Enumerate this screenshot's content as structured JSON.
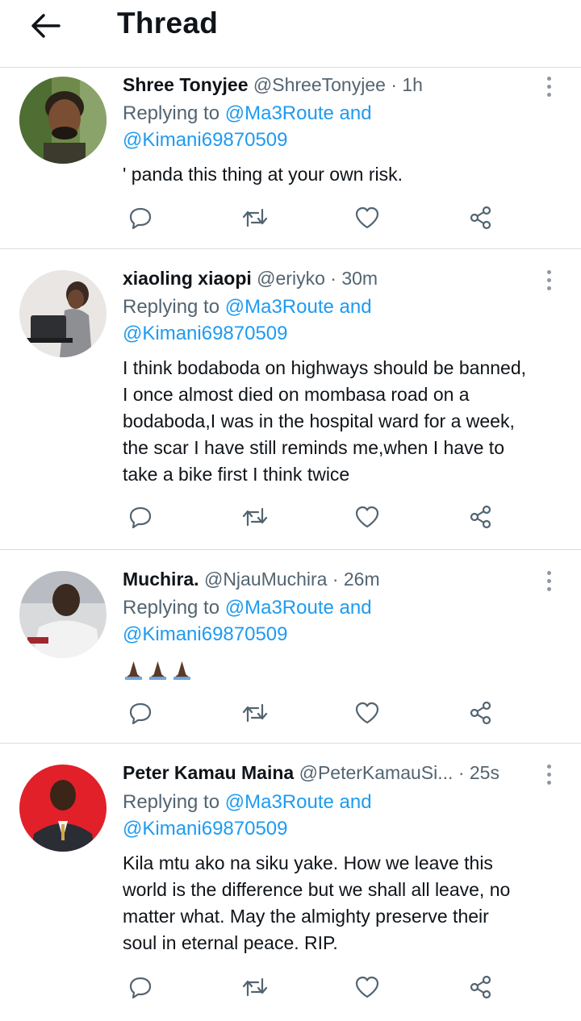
{
  "header": {
    "title": "Thread",
    "back_icon": "arrow-left-icon"
  },
  "tweets": [
    {
      "name": "Shree Tonyjee",
      "handle": "@ShreeTonyjee",
      "dot": "·",
      "time": "1h",
      "replying_prefix": "Replying to",
      "reply_user_1": "@Ma3Route",
      "reply_and": "and",
      "reply_user_2": "@Kimani69870509",
      "text": "' panda this thing at your own risk."
    },
    {
      "name": "xiaoling xiaopi",
      "handle": "@eriyko",
      "dot": "·",
      "time": "30m",
      "replying_prefix": "Replying to",
      "reply_user_1": "@Ma3Route",
      "reply_and": "and",
      "reply_user_2": "@Kimani69870509",
      "text_lines": [
        "I think bodaboda on highways should be banned,",
        "I once almost died on mombasa road on a",
        "bodaboda,I was in the hospital ward for a week,",
        "the scar I have still reminds me,when I have to",
        "take a bike first I think twice"
      ]
    },
    {
      "name": "Muchira.",
      "handle": "@NjauMuchira",
      "dot": "·",
      "time": "26m",
      "replying_prefix": "Replying to",
      "reply_user_1": "@Ma3Route",
      "reply_and": "and",
      "reply_user_2": "@Kimani69870509",
      "emoji_icon": "folded-hands-emoji",
      "emoji_count": 3
    },
    {
      "name": "Peter Kamau Maina",
      "handle": "@PeterKamauSi...",
      "dot": "·",
      "time": "25s",
      "replying_prefix": "Replying to",
      "reply_user_1": "@Ma3Route",
      "reply_and": "and",
      "reply_user_2": "@Kimani69870509",
      "text_lines": [
        "Kila mtu ako na siku yake. How we leave this",
        "world is the difference but we shall all leave, no",
        "matter what. May the almighty preserve their",
        "soul in eternal peace. RIP."
      ]
    }
  ],
  "colors": {
    "link": "#1d9bf0",
    "secondary_text": "#536471",
    "primary_text": "#0f1419",
    "divider": "#dcdcdc"
  },
  "icons": {
    "reply": "reply-icon",
    "retweet": "retweet-icon",
    "like": "like-heart-icon",
    "share": "share-icon",
    "more": "more-options-icon"
  }
}
